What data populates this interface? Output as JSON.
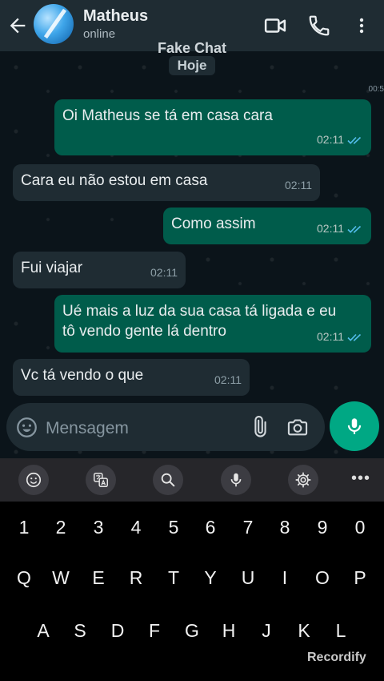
{
  "header": {
    "contact_name": "Matheus",
    "status": "online"
  },
  "overlay_title": "Fake Chat",
  "date_chip": "Hoje",
  "recording_time": "00:5",
  "messages": [
    {
      "direction": "out",
      "text": "Oi Matheus se tá em casa cara",
      "time": "02:11",
      "read": true
    },
    {
      "direction": "in",
      "text": "Cara eu não estou em casa",
      "time": "02:11"
    },
    {
      "direction": "out",
      "text": "Como assim",
      "time": "02:11",
      "read": true
    },
    {
      "direction": "in",
      "text": "Fui viajar",
      "time": "02:11"
    },
    {
      "direction": "out",
      "text_line1": "Ué mais a luz da sua casa tá ligada e eu",
      "text_line2": "tô vendo gente lá dentro",
      "time": "02:11",
      "read": true
    },
    {
      "direction": "in",
      "text": "Vc tá vendo o que",
      "time": "02:11"
    }
  ],
  "composer": {
    "placeholder": "Mensagem"
  },
  "keyboard": {
    "row_numbers": [
      "1",
      "2",
      "3",
      "4",
      "5",
      "6",
      "7",
      "8",
      "9",
      "0"
    ],
    "row_top": [
      "Q",
      "W",
      "E",
      "R",
      "T",
      "Y",
      "U",
      "I",
      "O",
      "P"
    ],
    "row_middle": [
      "A",
      "S",
      "D",
      "F",
      "G",
      "H",
      "J",
      "K",
      "L"
    ],
    "more": "•••"
  },
  "watermark": "Recordify",
  "colors": {
    "outgoing_bubble": "#005c4b",
    "incoming_bubble": "#1f2c33",
    "accent": "#00a884",
    "read_ticks": "#53bdeb"
  }
}
